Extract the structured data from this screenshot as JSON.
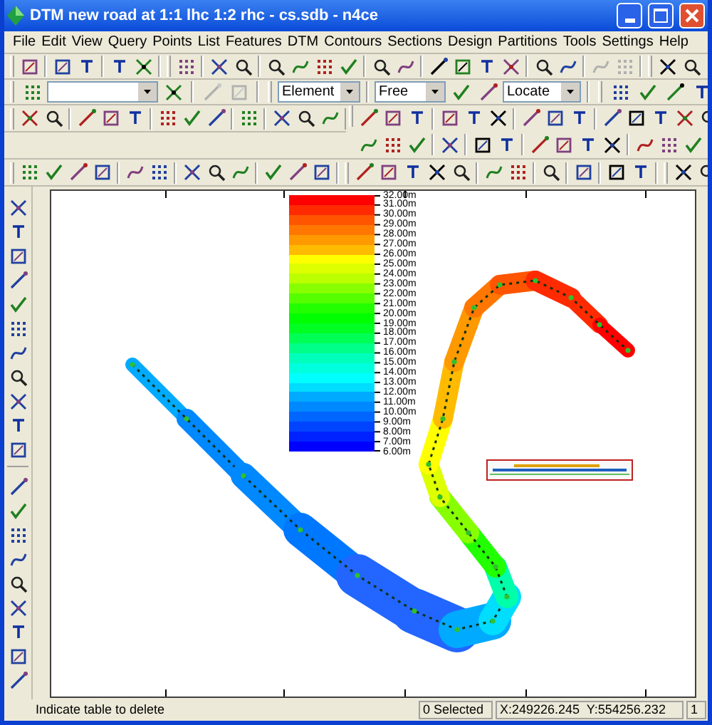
{
  "window": {
    "title": "DTM new road at 1:1 lhc 1:2 rhc - cs.sdb - n4ce"
  },
  "menu": [
    "File",
    "Edit",
    "View",
    "Query",
    "Points",
    "List",
    "Features",
    "DTM",
    "Contours",
    "Sections",
    "Design",
    "Partitions",
    "Tools",
    "Settings",
    "Help"
  ],
  "toolbar": {
    "dropdowns": [
      {
        "value": "Element"
      },
      {
        "value": "Free"
      },
      {
        "value": "Locate"
      }
    ]
  },
  "legend": {
    "entries": [
      {
        "label": "32.00m",
        "color": "#ff0000"
      },
      {
        "label": "31.00m",
        "color": "#ff2a00"
      },
      {
        "label": "30.00m",
        "color": "#ff5500"
      },
      {
        "label": "29.00m",
        "color": "#ff7700"
      },
      {
        "label": "28.00m",
        "color": "#ff9900"
      },
      {
        "label": "27.00m",
        "color": "#ffbb00"
      },
      {
        "label": "26.00m",
        "color": "#ffff00"
      },
      {
        "label": "25.00m",
        "color": "#ddff00"
      },
      {
        "label": "24.00m",
        "color": "#bbff00"
      },
      {
        "label": "23.00m",
        "color": "#88ff00"
      },
      {
        "label": "22.00m",
        "color": "#55ff00"
      },
      {
        "label": "21.00m",
        "color": "#22ff00"
      },
      {
        "label": "20.00m",
        "color": "#00ff00"
      },
      {
        "label": "19.00m",
        "color": "#00ff22"
      },
      {
        "label": "18.00m",
        "color": "#00ff55"
      },
      {
        "label": "17.00m",
        "color": "#00ff88"
      },
      {
        "label": "16.00m",
        "color": "#00ffbb"
      },
      {
        "label": "15.00m",
        "color": "#00ffdd"
      },
      {
        "label": "14.00m",
        "color": "#00ffff"
      },
      {
        "label": "13.00m",
        "color": "#00ddff"
      },
      {
        "label": "12.00m",
        "color": "#00aaff"
      },
      {
        "label": "11.00m",
        "color": "#0088ff"
      },
      {
        "label": "10.00m",
        "color": "#0066ff"
      },
      {
        "label": "9.00m",
        "color": "#0044ff"
      },
      {
        "label": "8.00m",
        "color": "#0022ff"
      },
      {
        "label": "7.00m",
        "color": "#0000ff"
      },
      {
        "label": "6.00m"
      }
    ]
  },
  "status_bar": {
    "message": "Indicate table to delete",
    "selected": "0 Selected",
    "coordinates": "X:249226.245  Y:554256.232",
    "page": "1"
  }
}
